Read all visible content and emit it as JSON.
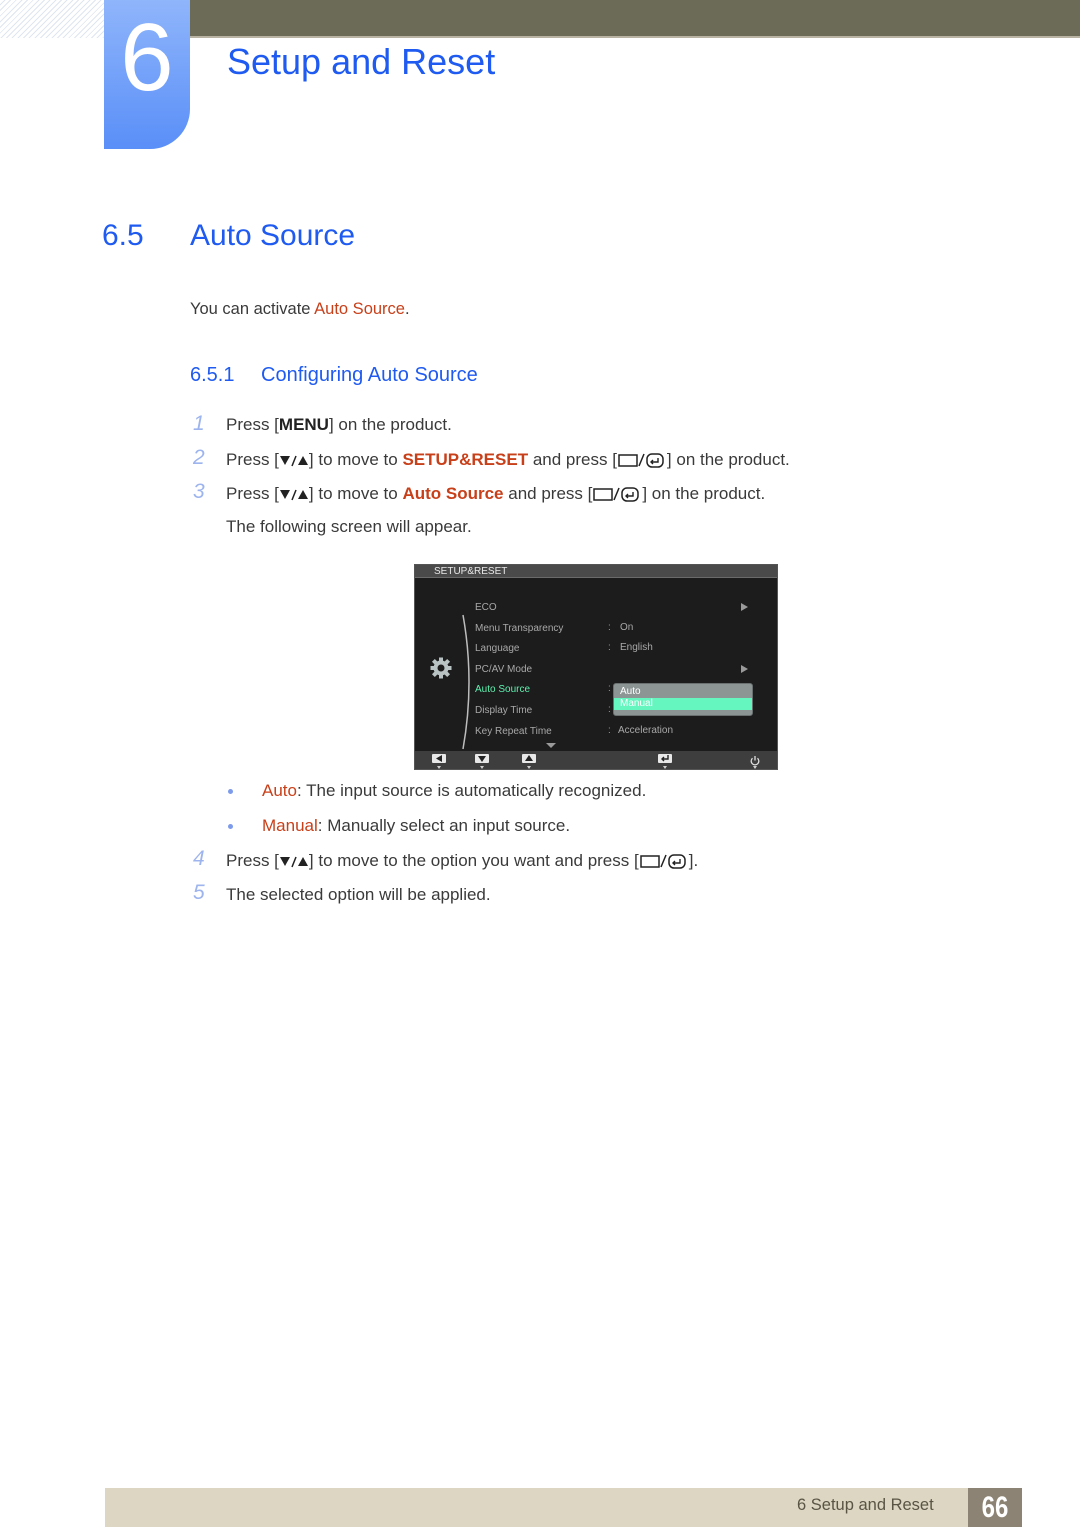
{
  "header": {
    "chapter_number": "6",
    "chapter_title": "Setup and Reset"
  },
  "section": {
    "number": "6.5",
    "title": "Auto Source",
    "intro_prefix": "You can activate ",
    "intro_highlight": "Auto Source",
    "intro_suffix": "."
  },
  "subsection": {
    "number": "6.5.1",
    "title": "Configuring Auto Source"
  },
  "steps": [
    {
      "num": "1",
      "p1": "Press [",
      "key": "MENU",
      "p2": "] on the product."
    },
    {
      "num": "2",
      "p1": "Press [",
      "p2": "] to move to ",
      "highlight": "SETUP&RESET",
      "p3": " and press [",
      "p4": "] on the product."
    },
    {
      "num": "3",
      "p1": "Press [",
      "p2": "] to move to ",
      "highlight": "Auto Source",
      "p3": " and press [",
      "p4": "] on the product."
    },
    {
      "note": "The following screen will appear."
    },
    {
      "num": "4",
      "p1": "Press [",
      "p2": "] to move to the option you want and press [",
      "p3": "]."
    },
    {
      "num": "5",
      "text": "The selected option will be applied."
    }
  ],
  "osd": {
    "title": "SETUP&RESET",
    "items": [
      {
        "label": "ECO",
        "value": "",
        "submenu": true
      },
      {
        "label": "Menu Transparency",
        "value": "On"
      },
      {
        "label": "Language",
        "value": "English"
      },
      {
        "label": "PC/AV Mode",
        "value": "",
        "submenu": true
      },
      {
        "label": "Auto Source",
        "value": "",
        "active": true
      },
      {
        "label": "Display Time",
        "value": ""
      },
      {
        "label": "Key Repeat Time",
        "value": "Acceleration"
      }
    ],
    "colon": ":",
    "popup_options": [
      "Auto",
      "Manual"
    ],
    "popup_selected": "Manual",
    "bottom_buttons": [
      "left-arrow",
      "down-arrow",
      "up-arrow",
      "enter",
      "power"
    ]
  },
  "bullets": [
    {
      "term": "Auto",
      "desc": ": The input source is automatically recognized."
    },
    {
      "term": "Manual",
      "desc": ": Manually select an input source."
    }
  ],
  "footer": {
    "section_label": "6 Setup and Reset",
    "page_number": "66"
  },
  "colors": {
    "heading_blue": "#1f5bf0",
    "highlight_orange": "#c8401a",
    "osd_active_green": "#5ff0b0",
    "footer_beige": "#dcd6c3",
    "page_box": "#8d8374",
    "top_bar": "#6c6b57"
  }
}
